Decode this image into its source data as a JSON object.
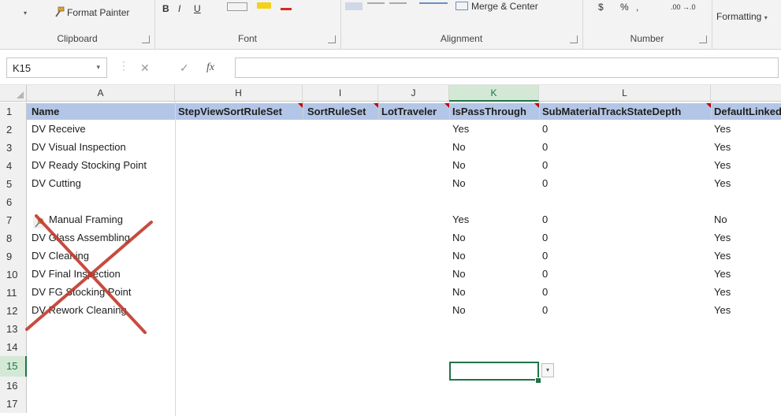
{
  "ribbon": {
    "clipboard": {
      "label": "Clipboard",
      "paste_arrow": "▾",
      "format_painter": "Format Painter"
    },
    "font": {
      "label": "Font",
      "bold": "B",
      "italic": "I",
      "underline": "U"
    },
    "alignment": {
      "label": "Alignment",
      "merge_center": "Merge & Center"
    },
    "number": {
      "label": "Number",
      "currency": "$",
      "percent": "%",
      "comma": ",",
      "decimals": ".00 →.0"
    },
    "styles": {
      "conditional_formatting": "Formatting"
    }
  },
  "formula_bar": {
    "name_box": "K15",
    "cancel_symbol": "✕",
    "enter_symbol": "✓",
    "fx_symbol": "fx",
    "formula": ""
  },
  "sheet": {
    "column_headers": [
      "A",
      "H",
      "I",
      "J",
      "K",
      "L"
    ],
    "selected_column": "K",
    "row_numbers": [
      "1",
      "2",
      "3",
      "4",
      "5",
      "6",
      "7",
      "8",
      "9",
      "10",
      "11",
      "12",
      "13",
      "14",
      "15",
      "16",
      "17"
    ],
    "selected_row": "15",
    "header_row": {
      "A": "Name",
      "H": "StepViewSortRuleSet",
      "I": "SortRuleSet",
      "J": "LotTraveler",
      "K": "IsPassThrough",
      "L": "SubMaterialTrackStateDepth",
      "M": "DefaultLinked"
    },
    "rows": [
      {
        "row": "2",
        "A": "DV Receive",
        "K": "Yes",
        "L": "0",
        "M": "Yes"
      },
      {
        "row": "3",
        "A": "DV Visual Inspection",
        "K": "No",
        "L": "0",
        "M": "Yes"
      },
      {
        "row": "4",
        "A": "DV Ready Stocking Point",
        "K": "No",
        "L": "0",
        "M": "Yes"
      },
      {
        "row": "5",
        "A": "DV Cutting",
        "K": "No",
        "L": "0",
        "M": "Yes"
      },
      {
        "row": "7",
        "A": "Manual Framing",
        "K": "Yes",
        "L": "0",
        "M": "No"
      },
      {
        "row": "8",
        "A": "DV Glass Assembling",
        "K": "No",
        "L": "0",
        "M": "Yes"
      },
      {
        "row": "9",
        "A": "DV Cleaning",
        "K": "No",
        "L": "0",
        "M": "Yes"
      },
      {
        "row": "10",
        "A": "DV Final Inspection",
        "K": "No",
        "L": "0",
        "M": "Yes"
      },
      {
        "row": "11",
        "A": "DV FG Stocking Point",
        "K": "No",
        "L": "0",
        "M": "Yes"
      },
      {
        "row": "12",
        "A": "DV Rework Cleaning",
        "K": "No",
        "L": "0",
        "M": "Yes"
      }
    ],
    "dropdown_arrow": "▾"
  },
  "colors": {
    "header_band": "#b4c6e7",
    "selection": "#217346",
    "cross_out": "#c0392b",
    "comment_marker": "#c00000"
  },
  "icons": [
    "format-painter-icon",
    "pin-icon",
    "cross-out-mark",
    "dropdown-arrow-icon"
  ]
}
